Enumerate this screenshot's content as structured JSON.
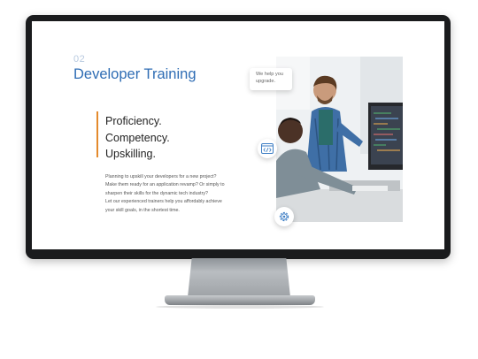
{
  "section": {
    "number": "02",
    "title": "Developer Training"
  },
  "taglines": [
    "Proficiency.",
    "Competency.",
    "Upskilling."
  ],
  "description": [
    "Planning to upskill your developers for a new project?",
    "Make them ready for an application revamp? Or simply to",
    "sharpen their skills for the dynamic tech industry?",
    "Let our experienced trainers help you affordably achieve",
    "your skill goals, in the shortest time."
  ],
  "callout": [
    "We help you",
    "upgrade."
  ],
  "icons": {
    "code": "code-window-icon",
    "gear": "gear-icon"
  },
  "colors": {
    "title": "#2f6db4",
    "accent_bar": "#e48a2d",
    "monitor_bezel": "#1a1b1d"
  }
}
